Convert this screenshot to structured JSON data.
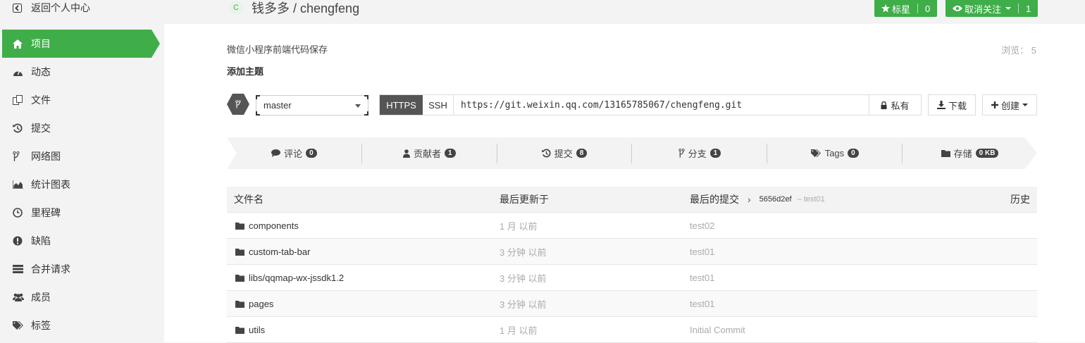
{
  "sidebar": {
    "back_label": "返回个人中心",
    "items": [
      {
        "label": "项目",
        "icon": "home-icon",
        "active": true
      },
      {
        "label": "动态",
        "icon": "dashboard-icon"
      },
      {
        "label": "文件",
        "icon": "files-icon"
      },
      {
        "label": "提交",
        "icon": "history-icon"
      },
      {
        "label": "网络图",
        "icon": "branch-icon"
      },
      {
        "label": "统计图表",
        "icon": "area-chart-icon"
      },
      {
        "label": "里程碑",
        "icon": "clock-icon"
      },
      {
        "label": "缺陷",
        "icon": "exclamation-icon"
      },
      {
        "label": "合并请求",
        "icon": "list-icon"
      },
      {
        "label": "成员",
        "icon": "users-icon"
      },
      {
        "label": "标签",
        "icon": "tags-icon"
      }
    ]
  },
  "header": {
    "avatar_letter": "C",
    "repo_title": "钱多多 / chengfeng",
    "star_label": "标星",
    "star_count": "0",
    "watch_label": "取消关注",
    "watch_count": "1"
  },
  "repo": {
    "description": "微信小程序前端代码保存",
    "add_topic": "添加主题",
    "views_label": "浏览：",
    "views_count": "5",
    "branch": "master",
    "https_label": "HTTPS",
    "ssh_label": "SSH",
    "clone_url": "https://git.weixin.qq.com/13165785067/chengfeng.git",
    "private_label": "私有",
    "download_label": "下载",
    "create_label": "创建"
  },
  "stats": [
    {
      "label": "评论",
      "count": "0",
      "icon": "comment-icon"
    },
    {
      "label": "贡献者",
      "count": "1",
      "icon": "user-icon"
    },
    {
      "label": "提交",
      "count": "8",
      "icon": "history-icon"
    },
    {
      "label": "分支",
      "count": "1",
      "icon": "branch-icon"
    },
    {
      "label": "Tags",
      "count": "0",
      "icon": "tags-icon"
    },
    {
      "label": "存储",
      "count": "0 KB",
      "icon": "folder-icon"
    }
  ],
  "table": {
    "headers": {
      "name": "文件名",
      "updated": "最后更新于",
      "last_commit": "最后的提交",
      "history": "历史"
    },
    "last_commit_sha": "5656d2ef",
    "last_commit_msg": "– test01",
    "rows": [
      {
        "name": "components",
        "updated": "1 月 以前",
        "commit": "test02"
      },
      {
        "name": "custom-tab-bar",
        "updated": "3 分钟 以前",
        "commit": "test01"
      },
      {
        "name": "libs/qqmap-wx-jssdk1.2",
        "updated": "3 分钟 以前",
        "commit": "test01"
      },
      {
        "name": "pages",
        "updated": "3 分钟 以前",
        "commit": "test01"
      },
      {
        "name": "utils",
        "updated": "1 月 以前",
        "commit": "Initial Commit"
      }
    ]
  },
  "colors": {
    "accent": "#3fae49",
    "dark": "#555555"
  }
}
